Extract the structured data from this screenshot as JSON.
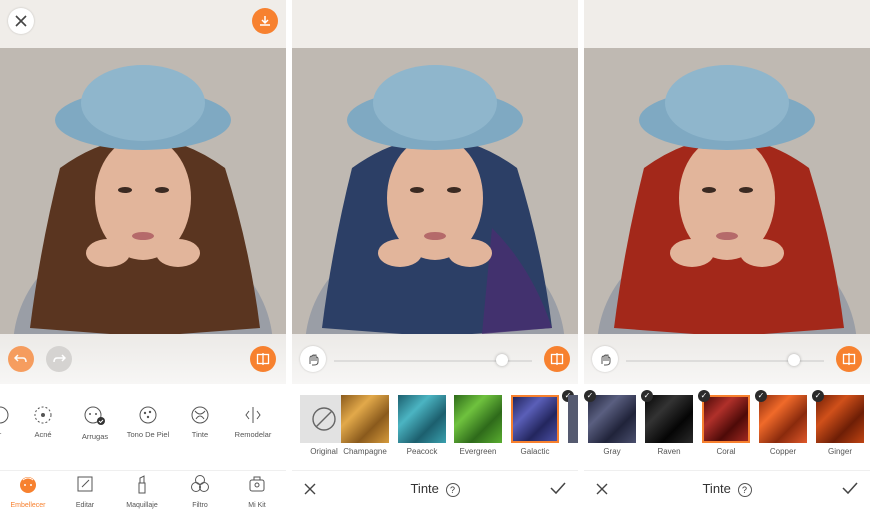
{
  "panel1": {
    "tools": [
      {
        "label": "r",
        "icon": "face-smooth-icon"
      },
      {
        "label": "Acné",
        "icon": "acne-icon"
      },
      {
        "label": "Arrugas",
        "icon": "wrinkles-icon"
      },
      {
        "label": "Tono De Piel",
        "icon": "skin-tone-icon"
      },
      {
        "label": "Tinte",
        "icon": "hair-dye-icon"
      },
      {
        "label": "Remodelar",
        "icon": "reshape-icon"
      }
    ],
    "nav": [
      {
        "label": "Embellecer",
        "icon": "face-icon"
      },
      {
        "label": "Editar",
        "icon": "edit-icon"
      },
      {
        "label": "Maquillaje",
        "icon": "lipstick-icon"
      },
      {
        "label": "Filtro",
        "icon": "filter-icon"
      },
      {
        "label": "Mi Kit",
        "icon": "kit-icon"
      }
    ],
    "active_nav": "Embellecer"
  },
  "panel2": {
    "title": "Tinte",
    "slider_value": 0.85,
    "swatches": [
      {
        "label": "Original",
        "color": "#d9d9d9"
      },
      {
        "label": "Champagne",
        "color": "#c98a2e"
      },
      {
        "label": "Peacock",
        "color": "#2f8e9e"
      },
      {
        "label": "Evergreen",
        "color": "#4a9a2e"
      },
      {
        "label": "Galactic",
        "color": "#3c3f8f"
      }
    ],
    "selected": "Galactic"
  },
  "panel3": {
    "title": "Tinte",
    "slider_value": 0.85,
    "swatches": [
      {
        "label": "Gray",
        "color": "#3c3f55"
      },
      {
        "label": "Raven",
        "color": "#141414"
      },
      {
        "label": "Coral",
        "color": "#8e1a14"
      },
      {
        "label": "Copper",
        "color": "#c9461a"
      },
      {
        "label": "Ginger",
        "color": "#b23c12"
      }
    ],
    "selected": "Coral"
  },
  "colors": {
    "accent": "#f7812f",
    "hair_panel1": "#5a3520",
    "hair_panel2": "#2c3f66",
    "hair_panel3": "#a3281a"
  }
}
